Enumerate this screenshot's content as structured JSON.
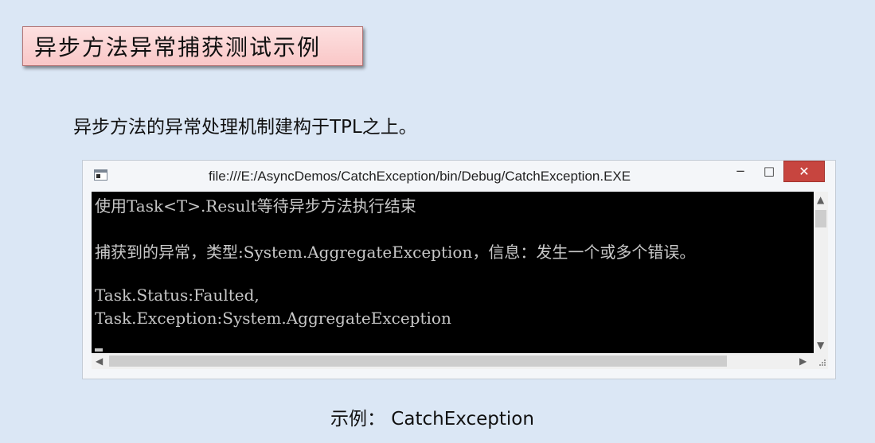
{
  "slide": {
    "title": "异步方法异常捕获测试示例",
    "subtitle": "异步方法的异常处理机制建构于TPL之上。",
    "caption": "示例： CatchException"
  },
  "window": {
    "title": "file:///E:/AsyncDemos/CatchException/bin/Debug/CatchException.EXE",
    "min_symbol": "−",
    "max_symbol": "□",
    "close_symbol": "✕"
  },
  "console": {
    "lines": [
      "使用Task<T>.Result等待异步方法执行结束",
      "捕获到的异常，类型:System.AggregateException，信息：发生一个或多个错误。",
      "Task.Status:Faulted,",
      "Task.Exception:System.AggregateException"
    ]
  },
  "scrollbars": {
    "up": "▲",
    "down": "▼",
    "left": "◀",
    "right": "▶"
  },
  "colors": {
    "background": "#dbe7f5",
    "title_fill": "#f9c7c7",
    "console_bg": "#000000",
    "console_text": "#c8c8c8",
    "close_button": "#c7453f"
  },
  "icons": [
    "console-app-icon",
    "minimize-icon",
    "maximize-icon",
    "close-icon",
    "scroll-up-icon",
    "scroll-down-icon",
    "scroll-left-icon",
    "scroll-right-icon",
    "resize-grip-icon"
  ]
}
